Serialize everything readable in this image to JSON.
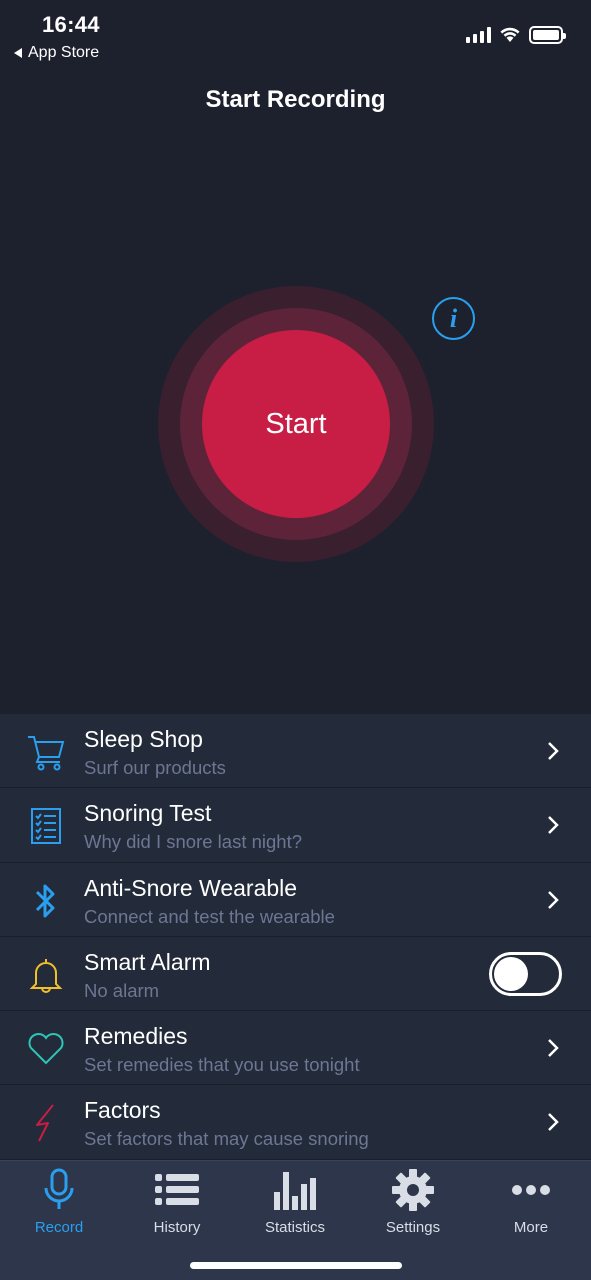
{
  "status_bar": {
    "time": "16:44",
    "back_app": "App Store"
  },
  "nav": {
    "title": "Start Recording"
  },
  "record": {
    "start_label": "Start",
    "info_glyph": "i"
  },
  "menu": {
    "items": [
      {
        "id": "sleep-shop",
        "title": "Sleep Shop",
        "subtitle": "Surf our products",
        "icon": "cart-icon",
        "icon_color": "#2a9ff0",
        "control": "chevron"
      },
      {
        "id": "snoring-test",
        "title": "Snoring Test",
        "subtitle": "Why did I snore last night?",
        "icon": "checklist-icon",
        "icon_color": "#2a9ff0",
        "control": "chevron"
      },
      {
        "id": "anti-snore-wearable",
        "title": "Anti-Snore Wearable",
        "subtitle": "Connect and test the wearable",
        "icon": "bluetooth-icon",
        "icon_color": "#2a9ff0",
        "control": "chevron"
      },
      {
        "id": "smart-alarm",
        "title": "Smart Alarm",
        "subtitle": "No alarm",
        "icon": "bell-icon",
        "icon_color": "#f0c02a",
        "control": "toggle",
        "toggle_on": false
      },
      {
        "id": "remedies",
        "title": "Remedies",
        "subtitle": "Set remedies that you use tonight",
        "icon": "heart-icon",
        "icon_color": "#2ec4b6",
        "control": "chevron"
      },
      {
        "id": "factors",
        "title": "Factors",
        "subtitle": "Set factors that may cause snoring",
        "icon": "lightning-icon",
        "icon_color": "#c81e45",
        "control": "chevron"
      }
    ]
  },
  "tabbar": {
    "tabs": [
      {
        "label": "Record",
        "icon": "microphone-icon",
        "active": true
      },
      {
        "label": "History",
        "icon": "list-icon",
        "active": false
      },
      {
        "label": "Statistics",
        "icon": "bar-chart-icon",
        "active": false
      },
      {
        "label": "Settings",
        "icon": "gear-icon",
        "active": false
      },
      {
        "label": "More",
        "icon": "more-dots-icon",
        "active": false
      }
    ]
  },
  "colors": {
    "background": "#1d212d",
    "accent": "#2a9ff0",
    "record": "#c81e45",
    "list_bg": "#232a39",
    "tabbar_bg": "#2d364b"
  }
}
